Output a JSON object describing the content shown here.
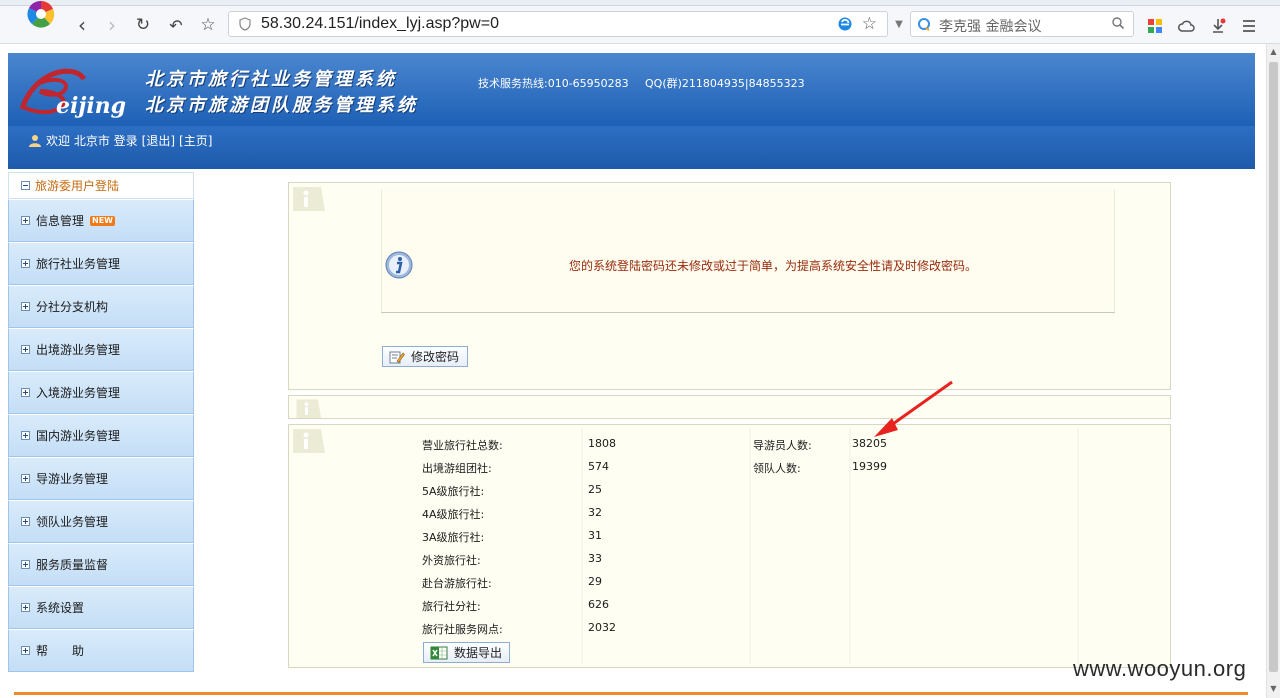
{
  "browser": {
    "url": "58.30.24.151/index_lyj.asp?pw=0",
    "search_placeholder": "李克强 金融会议"
  },
  "header": {
    "title_line1": "北京市旅行社业务管理系统",
    "title_line2": "北京市旅游团队服务管理系统",
    "hotline": "技术服务热线:010-65950283",
    "qq": "QQ(群)211804935|84855323",
    "welcome": "欢迎 北京市 登录",
    "logout": "[退出]",
    "home": "[主页]"
  },
  "sidebar": {
    "head": "旅游委用户登陆",
    "new_badge": "NEW",
    "items": [
      {
        "label": "信息管理"
      },
      {
        "label": "旅行社业务管理"
      },
      {
        "label": "分社分支机构"
      },
      {
        "label": "出境游业务管理"
      },
      {
        "label": "入境游业务管理"
      },
      {
        "label": "国内游业务管理"
      },
      {
        "label": "导游业务管理"
      },
      {
        "label": "领队业务管理"
      },
      {
        "label": "服务质量监督"
      },
      {
        "label": "系统设置"
      },
      {
        "label": "帮　　助"
      }
    ]
  },
  "notice": {
    "message": "您的系统登陆密码还未修改或过于简单，为提高系统安全性请及时修改密码。",
    "change_password": "修改密码"
  },
  "stats": {
    "left": [
      {
        "label": "营业旅行社总数:",
        "value": "1808"
      },
      {
        "label": "出境游组团社:",
        "value": "574"
      },
      {
        "label": "5A级旅行社:",
        "value": "25"
      },
      {
        "label": "4A级旅行社:",
        "value": "32"
      },
      {
        "label": "3A级旅行社:",
        "value": "31"
      },
      {
        "label": "外资旅行社:",
        "value": "33"
      },
      {
        "label": "赴台游旅行社:",
        "value": "29"
      },
      {
        "label": "旅行社分社:",
        "value": "626"
      },
      {
        "label": "旅行社服务网点:",
        "value": "2032"
      }
    ],
    "right": [
      {
        "label": "导游员人数:",
        "value": "38205"
      },
      {
        "label": "领队人数:",
        "value": "19399"
      }
    ],
    "export": "数据导出"
  },
  "watermark": "www.wooyun.org",
  "colors": {
    "header_blue": "#1c5fb5",
    "sidebar_bg": "#c4def6",
    "panel_bg": "#fefef3",
    "warning_text": "#9a2a0c",
    "arrow_red": "#e8231f",
    "accent_orange": "#f08a2a"
  }
}
